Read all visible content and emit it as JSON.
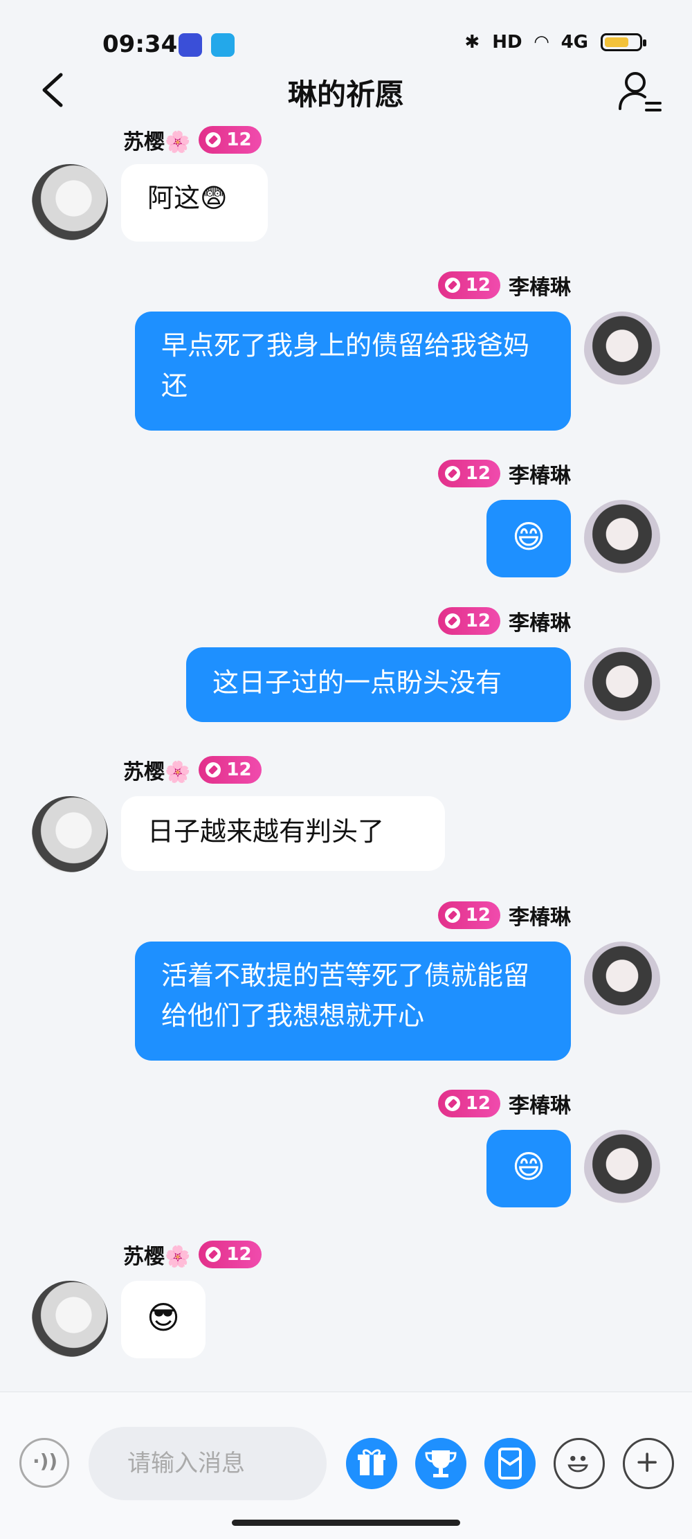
{
  "status_bar": {
    "time": "09:34",
    "hd": "HD",
    "network": "4G"
  },
  "header": {
    "title": "琳的祈愿"
  },
  "messages": [
    {
      "sender": "苏樱🌸",
      "level": "12",
      "text": "阿这😨"
    },
    {
      "sender": "李椿琳",
      "level": "12",
      "text": "早点死了我身上的债留给我爸妈还"
    },
    {
      "sender": "李椿琳",
      "level": "12",
      "text": "😄"
    },
    {
      "sender": "李椿琳",
      "level": "12",
      "text": "这日子过的一点盼头没有"
    },
    {
      "sender": "苏樱🌸",
      "level": "12",
      "text": "日子越来越有判头了"
    },
    {
      "sender": "李椿琳",
      "level": "12",
      "text": "活着不敢提的苦等死了债就能留给他们了我想想就开心"
    },
    {
      "sender": "李椿琳",
      "level": "12",
      "text": "😄"
    },
    {
      "sender": "苏樱🌸",
      "level": "12",
      "text": "😎"
    }
  ],
  "input": {
    "placeholder": "请输入消息"
  },
  "colors": {
    "accent": "#1e90ff",
    "badge": "#e2308a",
    "background": "#f3f5f8"
  }
}
